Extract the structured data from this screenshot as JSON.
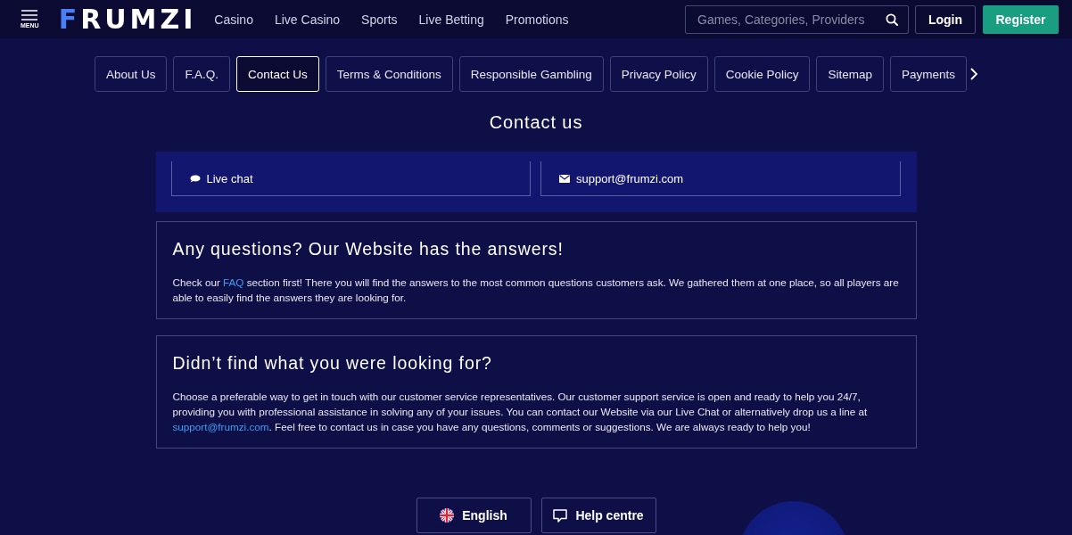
{
  "header": {
    "menu_label": "MENU",
    "logo": [
      {
        "text": "F",
        "accent": true
      },
      {
        "text": "RUMZI",
        "accent": false
      }
    ],
    "nav": [
      "Casino",
      "Live Casino",
      "Sports",
      "Live Betting",
      "Promotions"
    ],
    "search": {
      "placeholder": "Games, Categories, Providers"
    },
    "login": "Login",
    "register": "Register"
  },
  "info_tabs": [
    {
      "label": "About Us",
      "selected": false
    },
    {
      "label": "F.A.Q.",
      "selected": false
    },
    {
      "label": "Contact Us",
      "selected": true
    },
    {
      "label": "Terms & Conditions",
      "selected": false
    },
    {
      "label": "Responsible Gambling",
      "selected": false
    },
    {
      "label": "Privacy Policy",
      "selected": false
    },
    {
      "label": "Cookie Policy",
      "selected": false
    },
    {
      "label": "Sitemap",
      "selected": false
    },
    {
      "label": "Payments",
      "selected": false
    }
  ],
  "title": "Contact us",
  "contact_options": [
    {
      "kind": "chat",
      "label": "Live chat"
    },
    {
      "kind": "email",
      "label": "support@frumzi.com"
    }
  ],
  "cards": [
    {
      "heading": "Any questions? Our Website has the answers!",
      "text": [
        {
          "text": "Check our ",
          "link": false
        },
        {
          "text": "FAQ",
          "link": true
        },
        {
          "text": " section first! There you will find the answers to the most common questions customers ask. We gathered them at one place, so all players are able to easily find the answers they are looking for.",
          "link": false
        }
      ]
    },
    {
      "heading": "Didn’t find what you were looking for?",
      "text": [
        {
          "text": "Choose a preferable way to get in touch with our customer service representatives. Our customer support service is open and ready to help you 24/7, providing you with professional assistance in solving any of your issues. You can contact our Website via our Live Chat or alternatively drop us a line at ",
          "link": false
        },
        {
          "text": "support@frumzi.com",
          "link": true
        },
        {
          "text": ". Feel free to contact us in case you have any questions, comments or suggestions. We are always ready to help you!",
          "link": false
        }
      ]
    }
  ],
  "footer": [
    {
      "kind": "language",
      "label": "English"
    },
    {
      "kind": "help",
      "label": "Help centre"
    }
  ]
}
